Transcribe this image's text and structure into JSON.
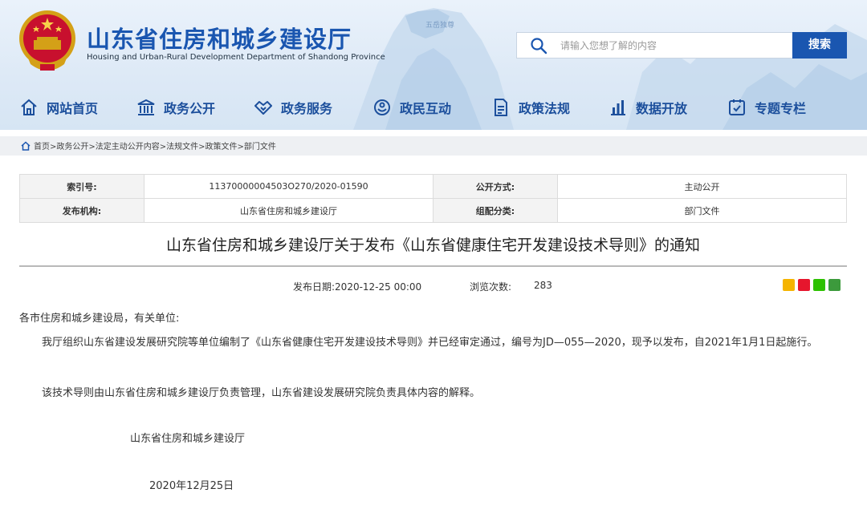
{
  "header": {
    "title": "山东省住房和城乡建设厅",
    "subtitle": "Housing and Urban-Rural Development Department of Shandong Province",
    "brand_color": "#1a56b0"
  },
  "search": {
    "placeholder": "请输入您想了解的内容",
    "button_label": "搜索"
  },
  "nav": {
    "items": [
      {
        "label": "网站首页",
        "icon": "home-icon"
      },
      {
        "label": "政务公开",
        "icon": "government-building-icon"
      },
      {
        "label": "政务服务",
        "icon": "handshake-icon"
      },
      {
        "label": "政民互动",
        "icon": "interaction-icon"
      },
      {
        "label": "政策法规",
        "icon": "document-icon"
      },
      {
        "label": "数据开放",
        "icon": "bar-chart-icon"
      },
      {
        "label": "专题专栏",
        "icon": "topic-icon"
      }
    ]
  },
  "breadcrumb": {
    "text": "首页>政务公开>法定主动公开内容>法规文件>政策文件>部门文件"
  },
  "meta": {
    "index_label": "索引号:",
    "index_value": "11370000004503O270/2020-01590",
    "open_mode_label": "公开方式:",
    "open_mode_value": "主动公开",
    "publisher_label": "发布机构:",
    "publisher_value": "山东省住房和城乡建设厅",
    "category_label": "组配分类:",
    "category_value": "部门文件"
  },
  "article": {
    "title": "山东省住房和城乡建设厅关于发布《山东省健康住宅开发建设技术导则》的通知",
    "pub_date": "发布日期:2020-12-25 00:00",
    "views_label": "浏览次数:",
    "views_count": "283",
    "salutation": "各市住房和城乡建设局，有关单位:",
    "para1": "我厅组织山东省建设发展研究院等单位编制了《山东省健康住宅开发建设技术导则》并已经审定通过，编号为JD—055—2020，现予以发布，自2021年1月1日起施行。",
    "para2": "该技术导则由山东省住房和城乡建设厅负责管理，山东省建设发展研究院负责具体内容的解释。",
    "signature": "山东省住房和城乡建设厅",
    "date": "2020年12月25日"
  },
  "share_icons": [
    "qzone-icon",
    "weibo-icon",
    "wechat-icon",
    "douban-icon"
  ]
}
